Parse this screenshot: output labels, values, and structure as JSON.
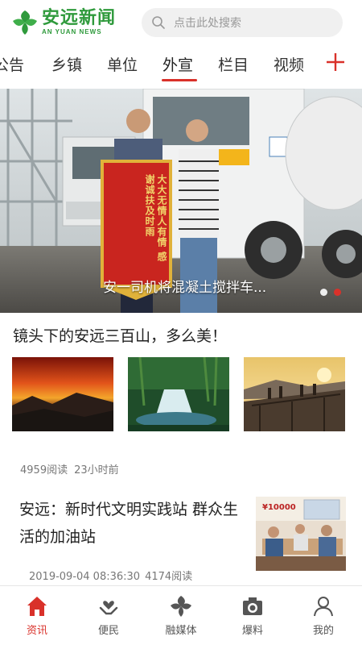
{
  "header": {
    "logo_cn": "安远新闻",
    "logo_en": "AN YUAN NEWS",
    "search_placeholder": "点击此处搜索"
  },
  "tabs": [
    {
      "label": "公告",
      "active": false
    },
    {
      "label": "乡镇",
      "active": false
    },
    {
      "label": "单位",
      "active": false
    },
    {
      "label": "外宣",
      "active": true
    },
    {
      "label": "栏目",
      "active": false
    },
    {
      "label": "视频",
      "active": false
    }
  ],
  "banner": {
    "caption": "安一司机将混凝土搅拌车...",
    "banner_text": "大大无情人有情 感谢诚扶及时雨",
    "dots": [
      {
        "active": false
      },
      {
        "active": true
      }
    ]
  },
  "article1": {
    "title": "镜头下的安远三百山，多么美！",
    "reads": "4959阅读",
    "time": "23小时前",
    "thumbs": [
      "sunset-mountain-photo",
      "waterfall-photo",
      "viewing-platform-photo"
    ]
  },
  "article2": {
    "title": "安远：新时代文明实践站 群众生活的加油站",
    "date": "2019-09-04 08:36:30",
    "reads": "4174阅读",
    "thumb_text": "¥10000"
  },
  "bottom_nav": [
    {
      "label": "资讯",
      "icon": "home-icon",
      "active": true
    },
    {
      "label": "便民",
      "icon": "service-hands-icon",
      "active": false
    },
    {
      "label": "融媒体",
      "icon": "media-logo-icon",
      "active": false
    },
    {
      "label": "爆料",
      "icon": "camera-icon",
      "active": false
    },
    {
      "label": "我的",
      "icon": "user-icon",
      "active": false
    }
  ],
  "colors": {
    "brand_green": "#2f9a3c",
    "accent_red": "#d9312a",
    "muted_text": "#777777"
  }
}
